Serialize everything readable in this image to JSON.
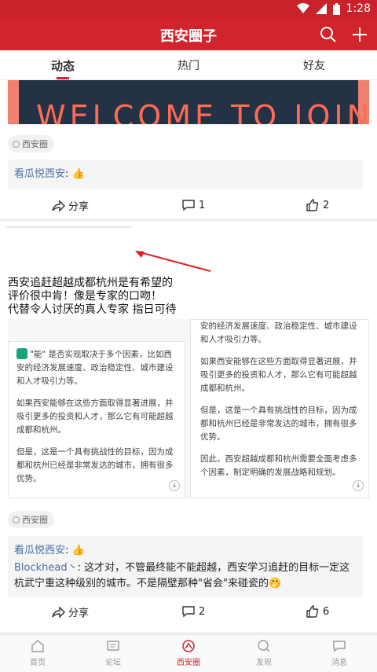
{
  "status_bar": {
    "time": "1:28"
  },
  "app_bar": {
    "title": "西安圈子",
    "search_icon": "search-icon",
    "add_icon": "plus-icon"
  },
  "tabs": [
    {
      "label": "动态",
      "active": true
    },
    {
      "label": "热门",
      "active": false
    },
    {
      "label": "好友",
      "active": false
    }
  ],
  "post1": {
    "banner_text": "WELCOME TO JOIN US",
    "circle_tag": "西安圈",
    "comment_author": "看瓜悦西安",
    "comment_suffix": ": 👍",
    "share_label": "分享",
    "comment_count": "1",
    "like_count": "2"
  },
  "post2": {
    "text_lines": [
      "西安追赶超越成都杭州是有希望的",
      "评价很中肯！像是专家的口吻！",
      "代替令人讨厌的真人专家 指日可待"
    ],
    "shot_left": [
      "\"能\" 是否实现取决于多个因素，比如西安的经济发展速度、政治稳定性、城市建设和人才吸引力等。",
      "如果西安能够在这些方面取得显著进展，并吸引更多的投资和人才，那么它有可能超越成都和杭州。",
      "但是，这是一个具有挑战性的目标，因为成都和杭州已经是非常发达的城市，拥有很多优势。"
    ],
    "shot_right": [
      "安的经济发展速度、政治稳定性、城市建设和人才吸引力等。",
      "如果西安能够在这些方面取得显著进展，并吸引更多的投资和人才，那么它有可能超越成都和杭州。",
      "但是，这是一个具有挑战性的目标，因为成都和杭州已经是非常发达的城市，拥有很多优势。",
      "因此，西安超越成都和杭州需要全面考虑多个因素，制定明确的发展战略和规划。"
    ],
    "circle_tag": "西安圈",
    "comment1_author": "看瓜悦西安",
    "comment1_suffix": ": 👍",
    "comment2_author": "Blockhead丶",
    "comment2_text": ": 这才对，不管最终能不能超越，西安学习追赶的目标一定这杭武宁重这种级别的城市。不是隔壁那种\"省会\"来碰瓷的🤭",
    "share_label": "分享",
    "comment_count": "2",
    "like_count": "6"
  },
  "bottom_nav": [
    {
      "label": "首页",
      "icon": "home-icon",
      "active": false
    },
    {
      "label": "论坛",
      "icon": "forum-icon",
      "active": false
    },
    {
      "label": "西安圈",
      "icon": "circle-icon",
      "active": true
    },
    {
      "label": "发现",
      "icon": "discover-icon",
      "active": false
    },
    {
      "label": "消息",
      "icon": "message-icon",
      "active": false
    }
  ],
  "colors": {
    "brand": "#d0252d",
    "link": "#4b6ea3"
  }
}
